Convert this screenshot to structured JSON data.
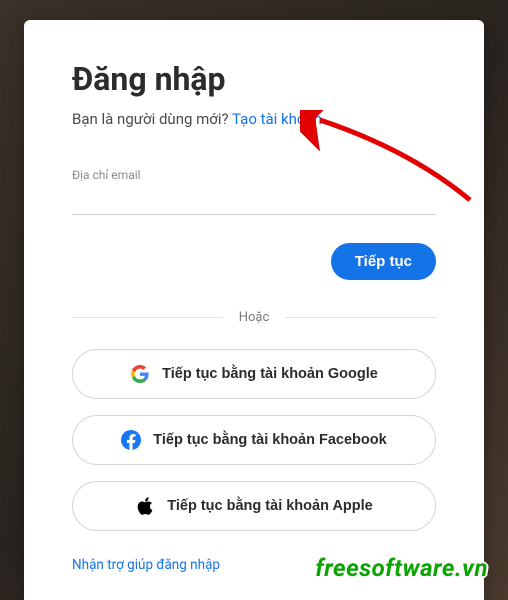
{
  "title": "Đăng nhập",
  "subtitle": {
    "prompt": "Bạn là người dùng mới? ",
    "link": "Tạo tài khoản"
  },
  "email": {
    "label": "Địa chỉ email"
  },
  "continue": "Tiếp tục",
  "divider": "Hoặc",
  "social": {
    "google": "Tiếp tục bằng tài khoản Google",
    "facebook": "Tiếp tục bằng tài khoản Facebook",
    "apple": "Tiếp tục bằng tài khoản Apple"
  },
  "help": "Nhận trợ giúp đăng nhập",
  "watermark": "freesoftware.vn"
}
